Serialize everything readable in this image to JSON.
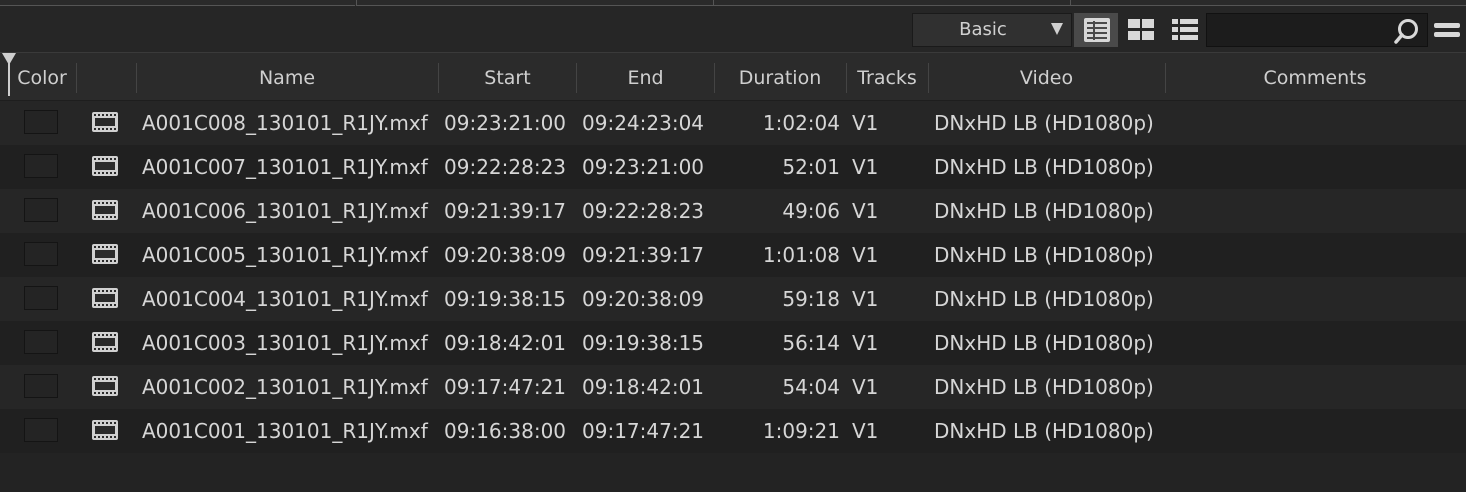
{
  "toolbar": {
    "view_mode": "Basic",
    "search": {
      "value": "",
      "placeholder": ""
    },
    "icons": [
      "grid-view-icon",
      "thumbnail-view-icon",
      "list-view-icon",
      "search-icon",
      "menu-icon"
    ],
    "active_view": "grid-view-icon"
  },
  "columns": {
    "color": "Color",
    "icon": "",
    "name": "Name",
    "start": "Start",
    "end": "End",
    "duration": "Duration",
    "tracks": "Tracks",
    "video": "Video",
    "comments": "Comments"
  },
  "clips": [
    {
      "name": "A001C008_130101_R1JY.mxf",
      "start": "09:23:21:00",
      "end": "09:24:23:04",
      "duration": "1:02:04",
      "tracks": "V1",
      "video": "DNxHD LB (HD1080p)",
      "comments": ""
    },
    {
      "name": "A001C007_130101_R1JY.mxf",
      "start": "09:22:28:23",
      "end": "09:23:21:00",
      "duration": "52:01",
      "tracks": "V1",
      "video": "DNxHD LB (HD1080p)",
      "comments": ""
    },
    {
      "name": "A001C006_130101_R1JY.mxf",
      "start": "09:21:39:17",
      "end": "09:22:28:23",
      "duration": "49:06",
      "tracks": "V1",
      "video": "DNxHD LB (HD1080p)",
      "comments": ""
    },
    {
      "name": "A001C005_130101_R1JY.mxf",
      "start": "09:20:38:09",
      "end": "09:21:39:17",
      "duration": "1:01:08",
      "tracks": "V1",
      "video": "DNxHD LB (HD1080p)",
      "comments": ""
    },
    {
      "name": "A001C004_130101_R1JY.mxf",
      "start": "09:19:38:15",
      "end": "09:20:38:09",
      "duration": "59:18",
      "tracks": "V1",
      "video": "DNxHD LB (HD1080p)",
      "comments": ""
    },
    {
      "name": "A001C003_130101_R1JY.mxf",
      "start": "09:18:42:01",
      "end": "09:19:38:15",
      "duration": "56:14",
      "tracks": "V1",
      "video": "DNxHD LB (HD1080p)",
      "comments": ""
    },
    {
      "name": "A001C002_130101_R1JY.mxf",
      "start": "09:17:47:21",
      "end": "09:18:42:01",
      "duration": "54:04",
      "tracks": "V1",
      "video": "DNxHD LB (HD1080p)",
      "comments": ""
    },
    {
      "name": "A001C001_130101_R1JY.mxf",
      "start": "09:16:38:00",
      "end": "09:17:47:21",
      "duration": "1:09:21",
      "tracks": "V1",
      "video": "DNxHD LB (HD1080p)",
      "comments": ""
    }
  ]
}
